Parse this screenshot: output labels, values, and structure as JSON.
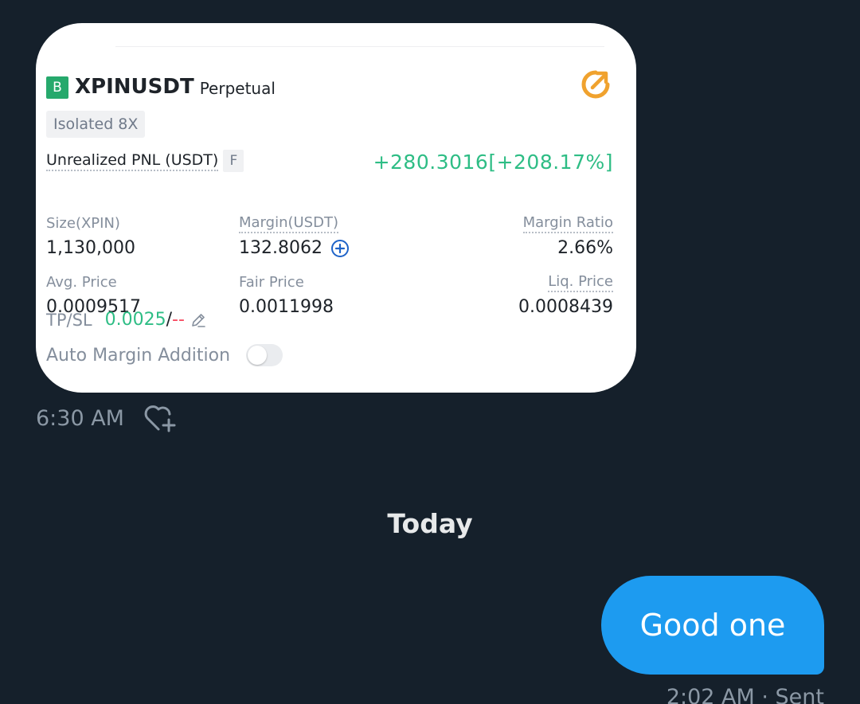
{
  "card": {
    "badge": "B",
    "symbol": "XPINUSDT",
    "contract_type": "Perpetual",
    "margin_mode": "Isolated 8X",
    "pnl_label": "Unrealized PNL (USDT)",
    "pnl_tag": "F",
    "pnl_value": "+280.3016[+208.17%]",
    "size_label": "Size(XPIN)",
    "size_value": "1,130,000",
    "margin_label": "Margin(USDT)",
    "margin_value": "132.8062",
    "margin_ratio_label": "Margin Ratio",
    "margin_ratio_value": "2.66%",
    "avg_price_label": "Avg. Price",
    "avg_price_value": "0.0009517",
    "fair_price_label": "Fair Price",
    "fair_price_value": "0.0011998",
    "liq_price_label": "Liq. Price",
    "liq_price_value": "0.0008439",
    "tpsl_label": "TP/SL",
    "tp_value": "0.0025",
    "tpsl_separator": "/",
    "sl_value": "--",
    "auto_margin_label": "Auto Margin Addition",
    "auto_margin_enabled": false
  },
  "received_time": "6:30 AM",
  "day_separator": "Today",
  "sent_message": {
    "text": "Good one",
    "meta": "2:02 AM · Sent"
  },
  "icons": {
    "share": "share-arrow-icon",
    "margin_add": "plus-circle-icon",
    "edit": "pencil-icon",
    "react": "heart-plus-icon"
  },
  "colors": {
    "background": "#15202b",
    "bubble": "#1d9bf0",
    "profit_green": "#2ebd85",
    "loss_red": "#f6465d",
    "share_orange": "#f0a22e"
  }
}
